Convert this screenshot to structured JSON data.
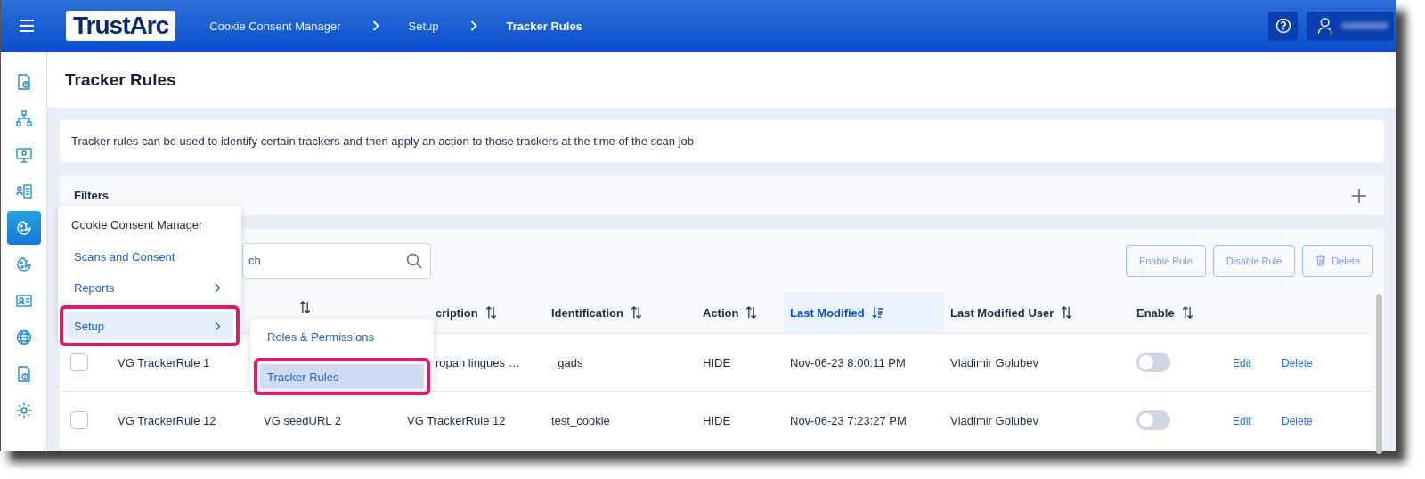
{
  "header": {
    "logo": "TrustArc",
    "breadcrumbs": [
      "Cookie Consent Manager",
      "Setup",
      "Tracker Rules"
    ]
  },
  "sidebar": {
    "items": [
      {
        "kind": "report",
        "selected": false
      },
      {
        "kind": "network",
        "selected": false
      },
      {
        "kind": "monitor",
        "selected": false
      },
      {
        "kind": "checklist",
        "selected": false
      },
      {
        "kind": "cookie",
        "selected": true
      },
      {
        "kind": "cookie",
        "selected": false
      },
      {
        "kind": "card",
        "selected": false
      },
      {
        "kind": "globe",
        "selected": false
      },
      {
        "kind": "alert-doc",
        "selected": false
      },
      {
        "kind": "gear",
        "selected": false
      }
    ]
  },
  "page_title": "Tracker Rules",
  "info": "Tracker rules can be used to identify certain trackers and then apply an action to those trackers at the time of the scan job",
  "filters": {
    "title": "Filters"
  },
  "search": {
    "placeholder": "ch"
  },
  "actions": [
    {
      "label": "Enable Rule",
      "kind": "text",
      "disabled": true
    },
    {
      "label": "Disable Rule",
      "kind": "text",
      "disabled": true
    },
    {
      "label": "Delete",
      "kind": "trash",
      "disabled": true
    }
  ],
  "table": {
    "columns": [
      null,
      {
        "sort_icon": true,
        "sorted": false
      },
      {
        "label": "cription",
        "cut": true,
        "sort_icon": true,
        "sorted": false
      },
      {
        "label": "Identification",
        "sort_icon": true,
        "sorted": false
      },
      {
        "label": "Action",
        "sort_icon": true,
        "sorted": false
      },
      {
        "label": "Last Modified",
        "sort_icon": true,
        "sorted": true
      },
      {
        "label": "Last Modified User",
        "sort_icon": true,
        "sorted": false
      },
      {
        "label": "Enable",
        "sort_icon": true,
        "sorted": false
      }
    ],
    "rows": [
      {
        "checked": false,
        "cells": [
          {
            "text": "VG TrackerRule 1"
          },
          null,
          {
            "text": "ropan lingues …",
            "cut": true
          },
          {
            "text": "_gads"
          },
          {
            "text": "HIDE"
          },
          {
            "text": "Nov-06-23 8:00:11 PM"
          },
          {
            "text": "Vladimir Golubev"
          }
        ],
        "enabled": false,
        "edit": "Edit",
        "delete": "Delete"
      },
      {
        "checked": false,
        "cells": [
          {
            "text": "VG TrackerRule 12"
          },
          {
            "text": "VG seedURL 2"
          },
          {
            "text": "VG TrackerRule 12"
          },
          {
            "text": "test_cookie"
          },
          {
            "text": "HIDE"
          },
          {
            "text": "Nov-06-23 7:23:27 PM"
          },
          {
            "text": "Vladimir Golubev"
          }
        ],
        "enabled": false,
        "edit": "Edit",
        "delete": "Delete"
      }
    ]
  },
  "menu": {
    "title": "Cookie Consent Manager",
    "items": [
      {
        "label": "Scans and Consent",
        "has_submenu": false,
        "selected": false,
        "highlighted": false
      },
      {
        "label": "Reports",
        "has_submenu": true,
        "selected": false,
        "highlighted": false
      },
      {
        "label": "Setup",
        "has_submenu": true,
        "selected": true,
        "highlighted": true
      }
    ]
  },
  "submenu": {
    "items": [
      {
        "label": "Roles & Permissions",
        "selected": false,
        "highlighted": false
      },
      {
        "label": "Tracker Rules",
        "selected": true,
        "highlighted": true
      }
    ]
  }
}
